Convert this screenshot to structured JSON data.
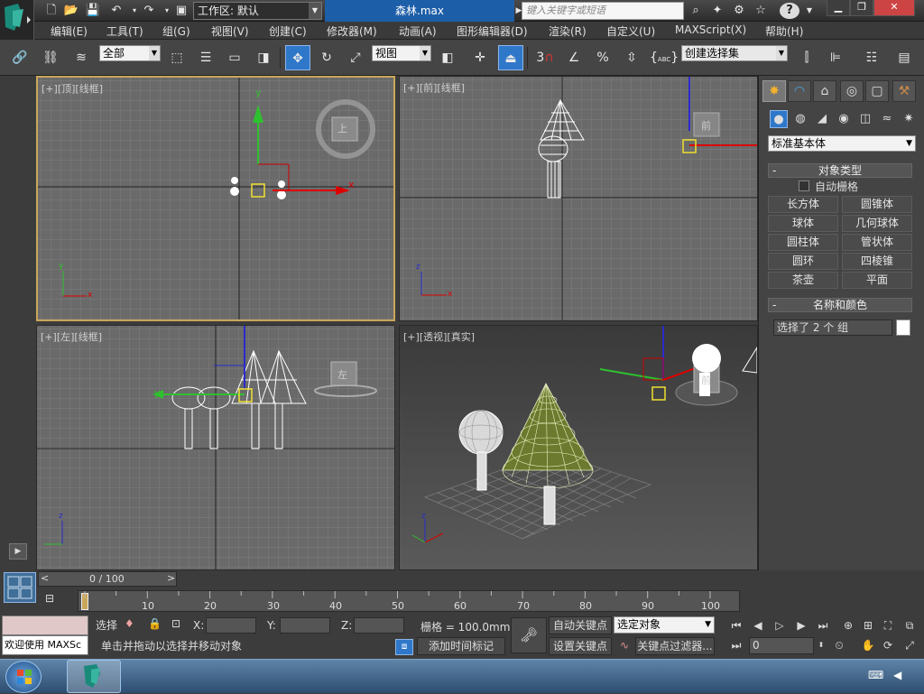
{
  "window": {
    "workspace_label": "工作区: 默认",
    "doc_title": "森林.max",
    "search_placeholder": "键入关键字或短语"
  },
  "menu": [
    "编辑(E)",
    "工具(T)",
    "组(G)",
    "视图(V)",
    "创建(C)",
    "修改器(M)",
    "动画(A)",
    "图形编辑器(D)",
    "渲染(R)",
    "自定义(U)",
    "MAXScript(X)",
    "帮助(H)"
  ],
  "toolbar": {
    "selection_filter": "全部",
    "coord_system": "视图",
    "spinner_3": "3",
    "named_selection": "创建选择集",
    "abc_label": "ABC"
  },
  "viewports": {
    "top": {
      "plus": "[+]",
      "name": "[顶]",
      "mode": "[线框]",
      "cube_label": "上"
    },
    "front": {
      "plus": "[+]",
      "name": "[前]",
      "mode": "[线框]",
      "cube_label": "前"
    },
    "left": {
      "plus": "[+]",
      "name": "[左]",
      "mode": "[线框]",
      "cube_label": "左"
    },
    "persp": {
      "plus": "[+]",
      "name": "[透视]",
      "mode": "[真实]",
      "cube_label": "前"
    },
    "axis_x": "x",
    "axis_y": "y",
    "axis_z": "z"
  },
  "command_panel": {
    "primitive_type": "标准基本体",
    "object_type_title": "对象类型",
    "autogrid_label": "自动栅格",
    "buttons": [
      "长方体",
      "圆锥体",
      "球体",
      "几何球体",
      "圆柱体",
      "管状体",
      "圆环",
      "四棱锥",
      "茶壶",
      "平面"
    ],
    "name_color_title": "名称和颜色",
    "name_value": "选择了 2 个 组",
    "object_color": "#ffffff"
  },
  "timeline": {
    "frame_indicator": "0 / 100",
    "ticks": [
      "0",
      "10",
      "20",
      "30",
      "40",
      "50",
      "60",
      "70",
      "80",
      "90",
      "100"
    ]
  },
  "status": {
    "maxscript_welcome": "欢迎使用 MAXSc",
    "select_label": "选择",
    "x_label": "X:",
    "y_label": "Y:",
    "z_label": "Z:",
    "grid_text": "栅格 = 100.0mm",
    "prompt": "单击并拖动以选择并移动对象",
    "add_time_tag": "添加时间标记",
    "auto_key": "自动关键点",
    "set_key": "设置关键点",
    "key_target": "选定对象",
    "key_filters": "关键点过滤器...",
    "frame_value": "0"
  },
  "colors": {
    "accent": "#2f78c9",
    "active_viewport_border": "#c9a65a",
    "title_doc_bg": "#1d5ea8"
  }
}
